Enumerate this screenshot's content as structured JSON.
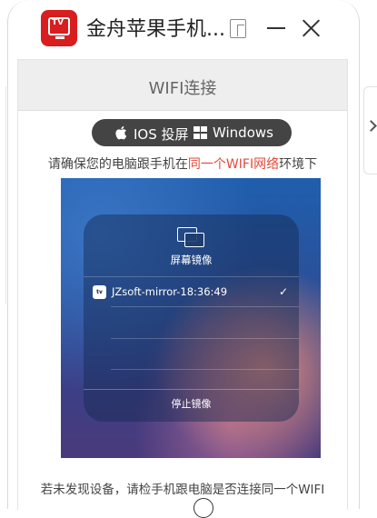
{
  "window": {
    "title": "金舟苹果手机...",
    "logo_text": "TV"
  },
  "panel": {
    "header": "WIFI连接",
    "toggle": {
      "ios_label": "IOS 投屏",
      "windows_label": "Windows"
    },
    "hint": {
      "before": "请确保您的电脑跟手机在",
      "highlight": "同一个WIFI网络",
      "after": "环境下"
    },
    "screenshot": {
      "title": "屏幕镜像",
      "device_icon_text": "tv",
      "device_name": "JZsoft-mirror-18:36:49",
      "check": "✓",
      "stop_label": "停止镜像"
    },
    "notice": "若未发现设备，请检手机跟电脑是否连接同一个WIFI"
  },
  "colors": {
    "logo_red": "#d81e1e",
    "highlight": "#e24a3a",
    "toggle_bg": "#444444"
  },
  "icons": [
    "tv-logo-icon",
    "pip-icon",
    "minimize-icon",
    "close-icon",
    "apple-icon",
    "windows-icon",
    "screen-mirror-icon",
    "apple-tv-icon",
    "check-icon",
    "chevron-right-icon",
    "help-icon"
  ]
}
